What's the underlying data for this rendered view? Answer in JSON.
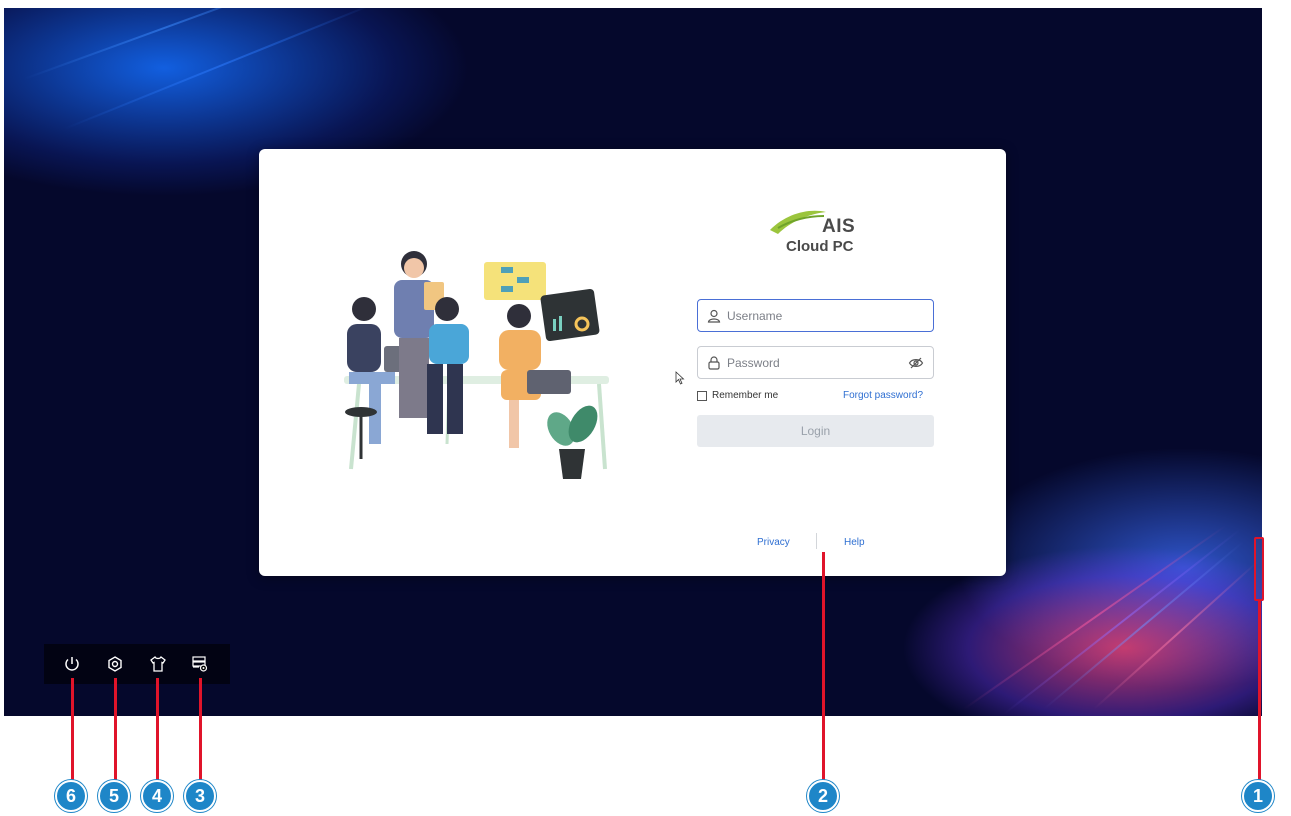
{
  "brand": {
    "logo_text": "AIS",
    "product_name": "Cloud PC",
    "accent_color": "#2f6fd2",
    "logo_green": "#9bc53d"
  },
  "login": {
    "username_placeholder": "Username",
    "password_placeholder": "Password",
    "remember_label": "Remember me",
    "forgot_label": "Forgot password?",
    "login_label": "Login"
  },
  "footer": {
    "privacy_label": "Privacy",
    "help_label": "Help"
  },
  "toolbar": {
    "items": [
      {
        "icon": "power-icon"
      },
      {
        "icon": "settings-icon"
      },
      {
        "icon": "theme-shirt-icon"
      },
      {
        "icon": "server-settings-icon"
      }
    ]
  },
  "annotations": {
    "badge_1": "1",
    "badge_2": "2",
    "badge_3": "3",
    "badge_4": "4",
    "badge_5": "5",
    "badge_6": "6",
    "line_color": "#e0142a",
    "badge_color": "#1e86c8"
  }
}
